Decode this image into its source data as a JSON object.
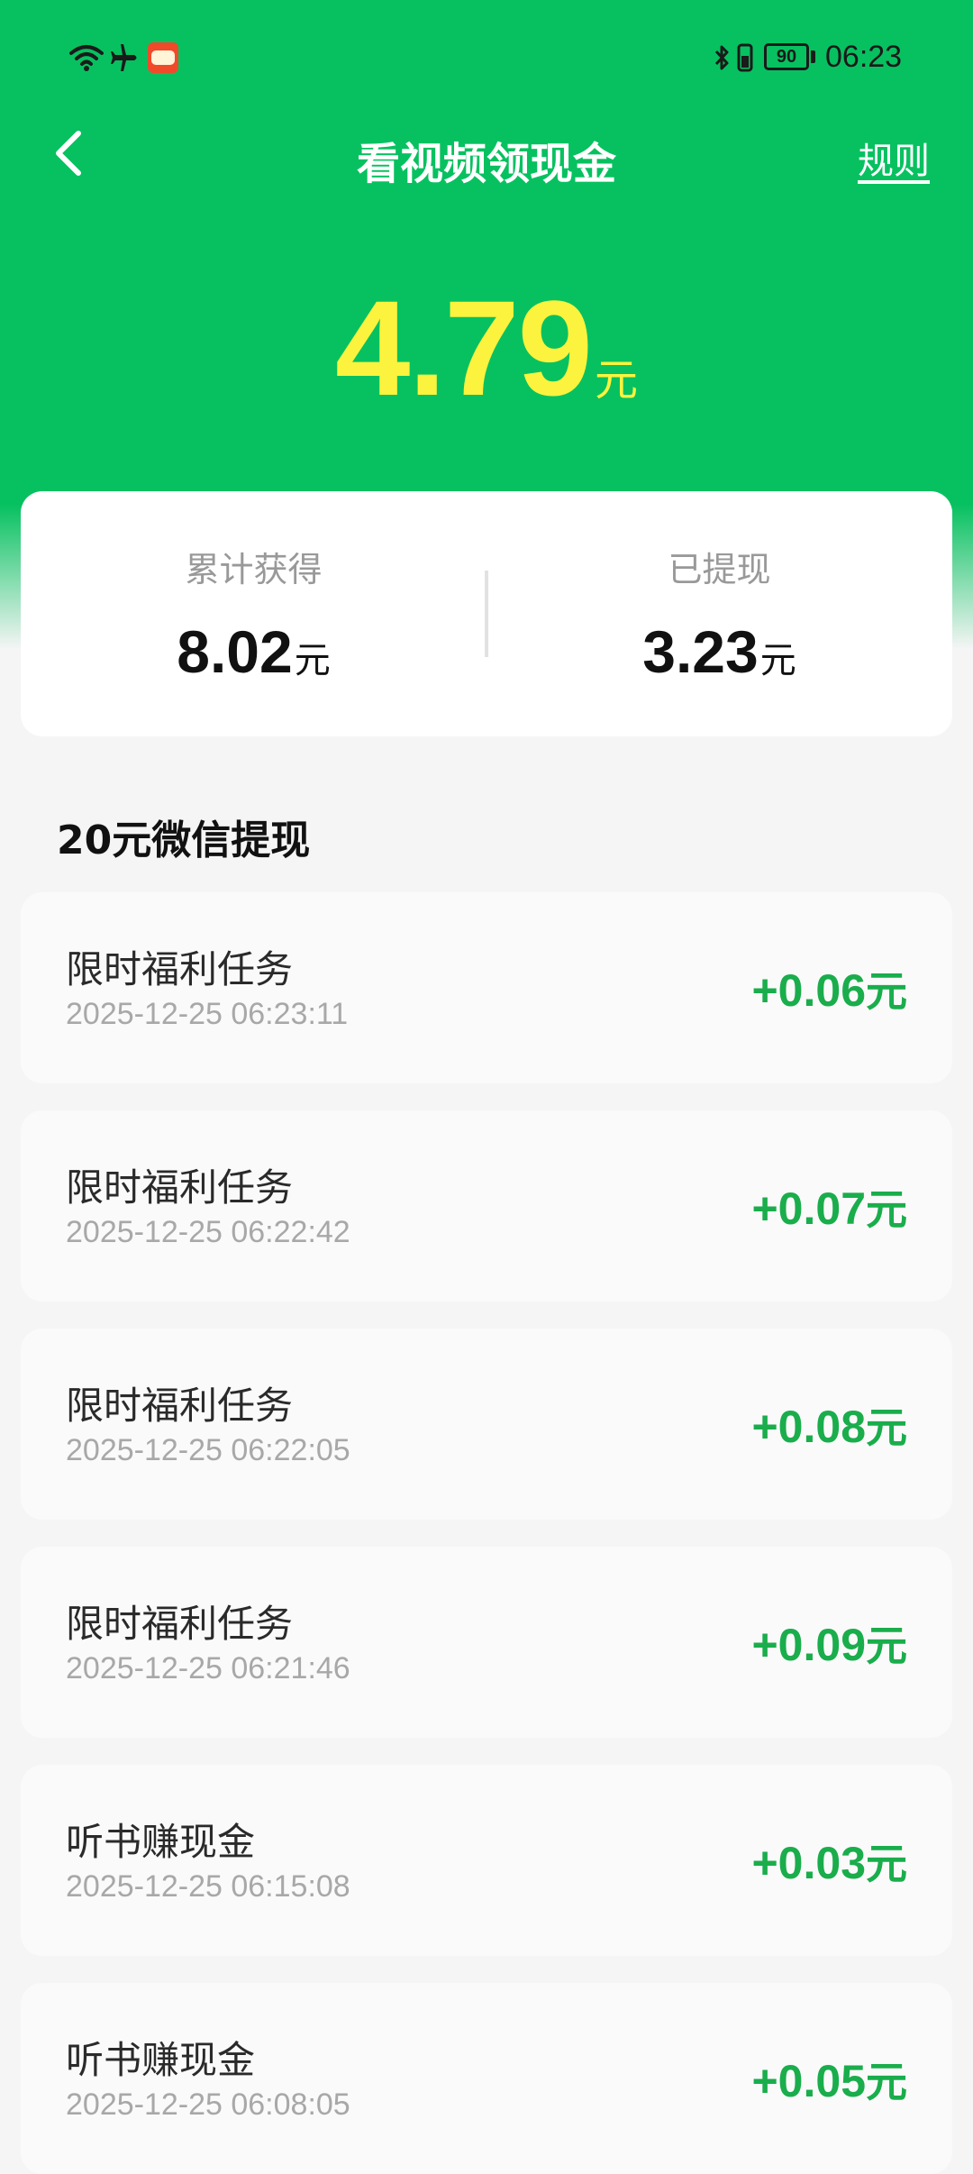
{
  "status_bar": {
    "time": "06:23",
    "battery": "90",
    "icons": [
      "wifi-icon",
      "airplane-icon",
      "app-notification-icon",
      "bluetooth-icon",
      "phone-vibrate-icon",
      "battery-icon"
    ]
  },
  "header": {
    "title": "看视频领现金",
    "rules_label": "规则",
    "back_icon": "chevron-left-icon"
  },
  "balance": {
    "amount": "4.79",
    "unit": "元"
  },
  "stats": {
    "total_label": "累计获得",
    "total_value": "8.02",
    "total_unit": "元",
    "withdrawn_label": "已提现",
    "withdrawn_value": "3.23",
    "withdrawn_unit": "元"
  },
  "section_title": "20元微信提现",
  "records": [
    {
      "title": "限时福利任务",
      "time": "2025-12-25 06:23:11",
      "amount": "+0.06",
      "unit": "元"
    },
    {
      "title": "限时福利任务",
      "time": "2025-12-25 06:22:42",
      "amount": "+0.07",
      "unit": "元"
    },
    {
      "title": "限时福利任务",
      "time": "2025-12-25 06:22:05",
      "amount": "+0.08",
      "unit": "元"
    },
    {
      "title": "限时福利任务",
      "time": "2025-12-25 06:21:46",
      "amount": "+0.09",
      "unit": "元"
    },
    {
      "title": "听书赚现金",
      "time": "2025-12-25 06:15:08",
      "amount": "+0.03",
      "unit": "元"
    },
    {
      "title": "听书赚现金",
      "time": "2025-12-25 06:08:05",
      "amount": "+0.05",
      "unit": "元"
    }
  ],
  "colors": {
    "brand_green": "#07c160",
    "balance_yellow": "#fbf33d",
    "amount_green": "#1aad4c"
  }
}
